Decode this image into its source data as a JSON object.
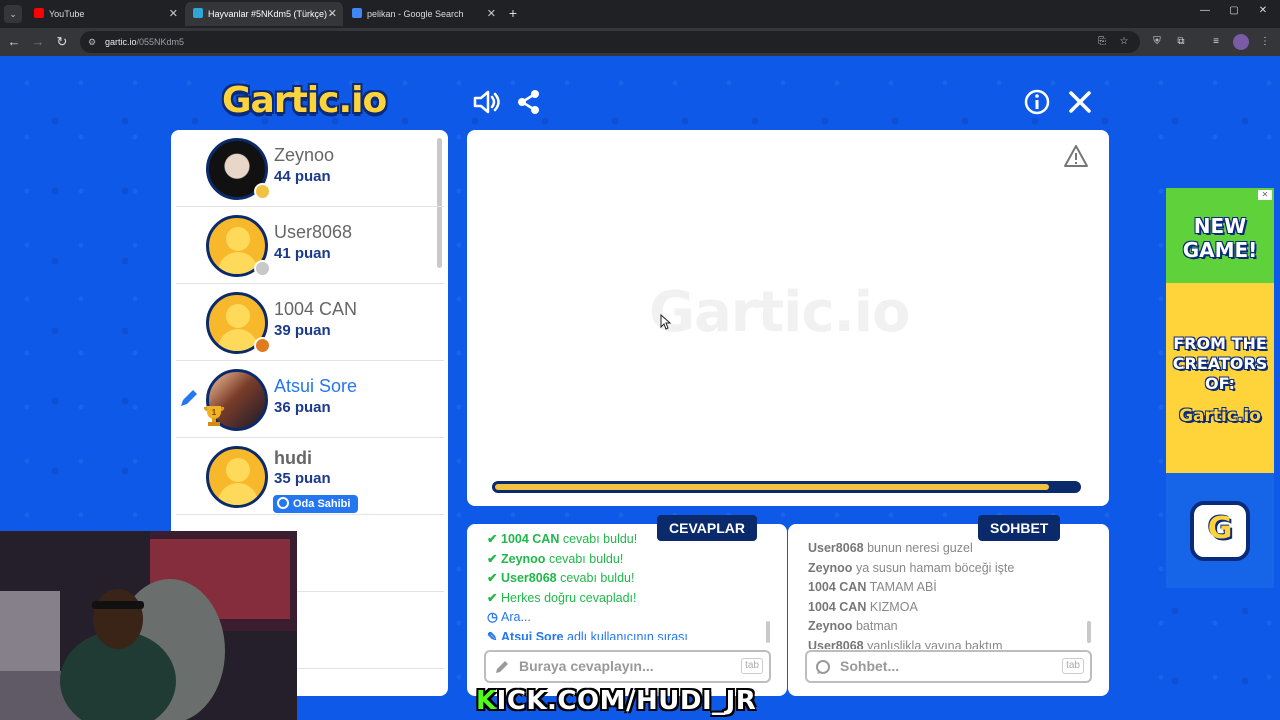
{
  "browser": {
    "tabs": [
      {
        "title": "YouTube",
        "favicon_color": "#ff0000",
        "active": false
      },
      {
        "title": "Hayvanlar #5NKdm5 (Türkçe) - ",
        "favicon_color": "#2ea6d8",
        "active": true
      },
      {
        "title": "pelikan - Google Search",
        "favicon_color": "#4285f4",
        "active": false
      }
    ],
    "new_tab": "+",
    "window_controls": [
      "—",
      "▢",
      "✕"
    ],
    "url_host": "gartic.io",
    "url_path": "/055NKdm5"
  },
  "header": {
    "logo": "Gartic.io",
    "icons": [
      "sound-icon",
      "share-icon",
      "info-icon",
      "close-icon"
    ]
  },
  "players": [
    {
      "name": "Zeynoo",
      "score": "44 puan",
      "avatar": "photo",
      "status_color": "#f0c23f"
    },
    {
      "name": "User8068",
      "score": "41 puan",
      "avatar": "default",
      "status_color": "#c8c8c8"
    },
    {
      "name": "1004 CAN",
      "score": "39 puan",
      "avatar": "default",
      "status_color": "#e07b1f"
    },
    {
      "name": "Atsui Sore",
      "score": "36 puan",
      "avatar": "photo",
      "drawing": true,
      "rank": "1"
    },
    {
      "name": "hudi",
      "score": "35 puan",
      "avatar": "default",
      "badge": "Oda Sahibi"
    }
  ],
  "canvas": {
    "watermark": "Gartic.io",
    "timer_progress": 0.95
  },
  "answers": {
    "title": "CEVAPLAR",
    "placeholder": "Buraya cevaplayın...",
    "tab_hint": "tab",
    "messages": [
      {
        "user": "1004 CAN",
        "text": "cevabı buldu!",
        "type": "ok"
      },
      {
        "user": "Zeynoo",
        "text": "cevabı buldu!",
        "type": "ok"
      },
      {
        "user": "User8068",
        "text": "cevabı buldu!",
        "type": "ok"
      },
      {
        "user": "",
        "text": "Herkes doğru cevapladı!",
        "type": "ok"
      },
      {
        "user": "",
        "text": "Ara...",
        "type": "clock"
      },
      {
        "user": "Atsui Sore",
        "text": "adlı kullanıcının sırası",
        "type": "pencil"
      }
    ]
  },
  "chat": {
    "title": "SOHBET",
    "placeholder": "Sohbet...",
    "tab_hint": "tab",
    "messages": [
      {
        "user": "User8068",
        "text": "bunun neresi guzel"
      },
      {
        "user": "Zeynoo",
        "text": "ya susun hamam böceği işte"
      },
      {
        "user": "1004 CAN",
        "text": "TAMAM ABİ"
      },
      {
        "user": "1004 CAN",
        "text": "KIZMOA"
      },
      {
        "user": "Zeynoo",
        "text": "batman"
      },
      {
        "user": "User8068",
        "text": "yanlışlikla yayına baktım"
      }
    ]
  },
  "ad": {
    "line1": "NEW",
    "line2": "GAME!",
    "line3": "FROM THE",
    "line4": "CREATORS",
    "line5": "OF:",
    "logo": "Gartic.io",
    "badge": "G"
  },
  "overlay": {
    "kick_prefix": "K",
    "kick_rest": "ICK.COM/HUDI_JR"
  },
  "colors": {
    "brand_blue": "#0f59e8",
    "navy": "#0b2a6b",
    "accent_yellow": "#f0c23f",
    "success_green": "#1fb84a",
    "info_blue": "#2477ee",
    "kick_green": "#53fc18"
  }
}
